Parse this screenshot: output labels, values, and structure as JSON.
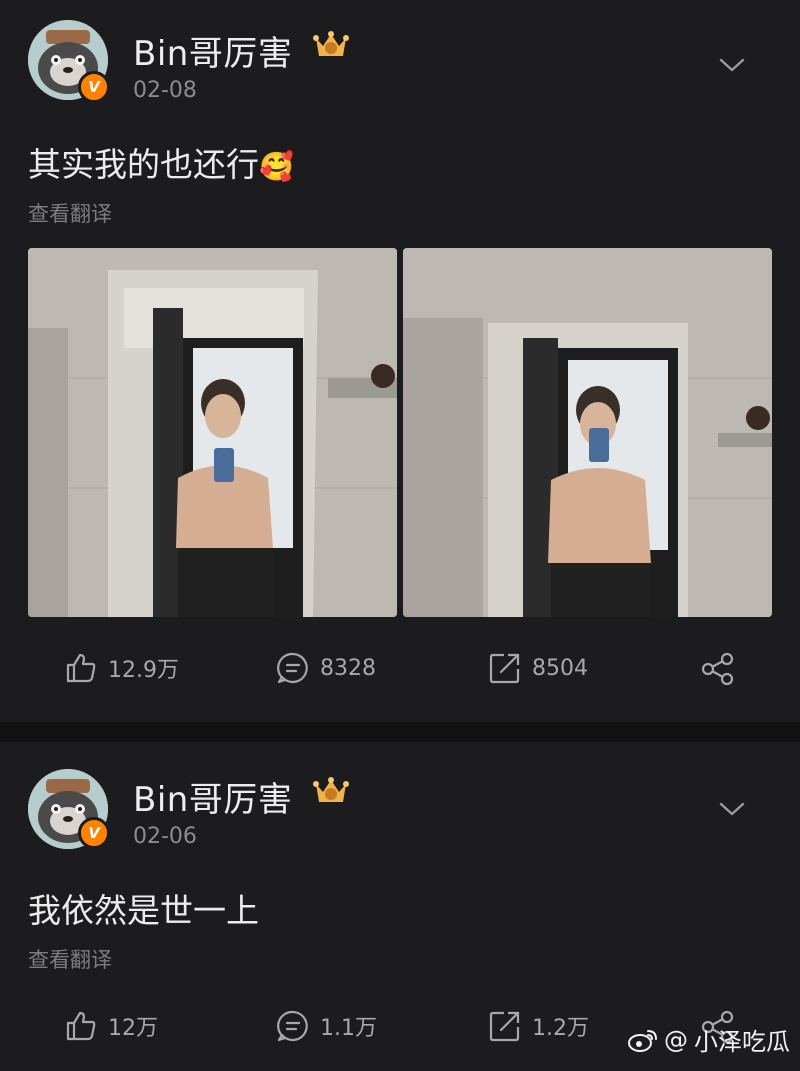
{
  "posts": [
    {
      "author": "Bin哥厉害",
      "date": "02-08",
      "text": "其实我的也还行",
      "emoji": "🥰",
      "translate": "查看翻译",
      "likes": "12.9万",
      "comments": "8328",
      "reposts": "8504"
    },
    {
      "author": "Bin哥厉害",
      "date": "02-06",
      "text": "我依然是世一上",
      "translate": "查看翻译",
      "likes": "12万",
      "comments": "1.1万",
      "reposts": "1.2万"
    }
  ],
  "verified_mark": "V",
  "watermark": {
    "prefix": "@",
    "account": "小泽吃瓜"
  },
  "colors": {
    "background": "#1c1c1e",
    "divider": "#121212",
    "verified_badge": "#ff8200",
    "crown": "#f0b24a"
  }
}
